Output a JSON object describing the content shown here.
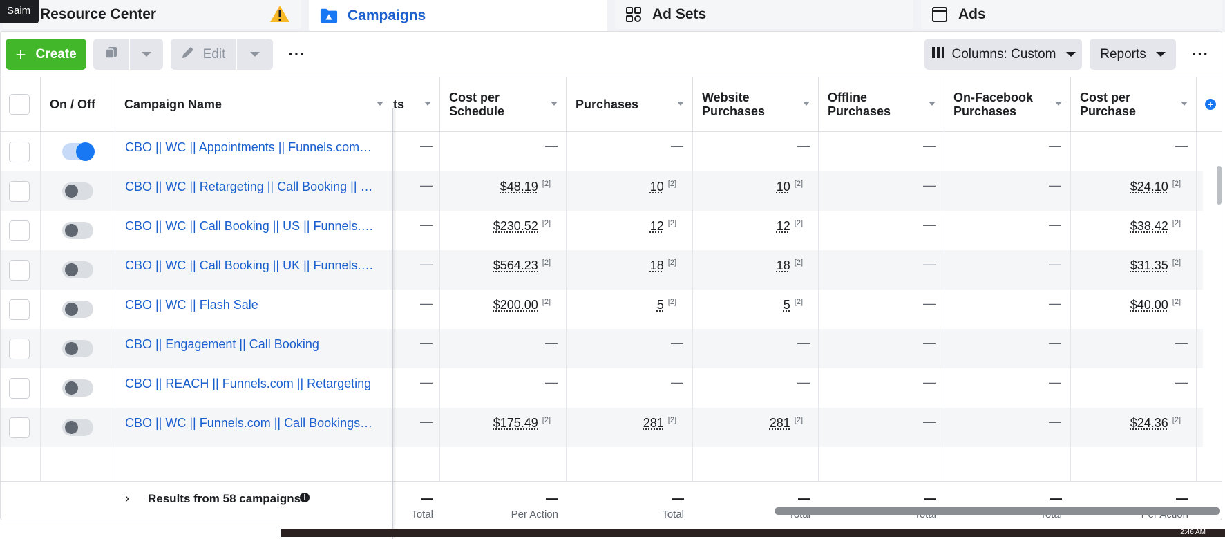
{
  "tabs": [
    {
      "label": "Resource Center",
      "icon": "warning-icon"
    },
    {
      "label": "Campaigns",
      "icon": "campaign-folder-icon"
    },
    {
      "label": "Ad Sets",
      "icon": "grid-icon"
    },
    {
      "label": "Ads",
      "icon": "ad-window-icon"
    }
  ],
  "user_badge": "Saim",
  "toolbar": {
    "create_label": "Create",
    "edit_label": "Edit",
    "columns_label": "Columns: Custom",
    "reports_label": "Reports"
  },
  "columns": {
    "on_off": "On / Off",
    "campaign_name": "Campaign Name",
    "partial": "ts",
    "cost_per_schedule": "Cost per Schedule",
    "purchases": "Purchases",
    "website_purchases": "Website Purchases",
    "offline_purchases": "Offline Purchases",
    "on_facebook_purchases": "On-Facebook Purchases",
    "cost_per_purchase": "Cost per Purchase"
  },
  "rows": [
    {
      "name": "CBO || WC || Appointments || Funnels.com || S...",
      "on": true,
      "partial": "—",
      "cost_per_schedule": "—",
      "purchases": "—",
      "website_purchases": "—",
      "offline_purchases": "—",
      "on_facebook_purchases": "—",
      "cost_per_purchase": "—"
    },
    {
      "name": "CBO || WC || Retargeting || Call Booking || Fun...",
      "on": false,
      "partial": "—",
      "cost_per_schedule": "$48.19",
      "purchases": "10",
      "website_purchases": "10",
      "offline_purchases": "—",
      "on_facebook_purchases": "—",
      "cost_per_purchase": "$24.10"
    },
    {
      "name": "CBO || WC || Call Booking || US || Funnels.com",
      "on": false,
      "partial": "—",
      "cost_per_schedule": "$230.52",
      "purchases": "12",
      "website_purchases": "12",
      "offline_purchases": "—",
      "on_facebook_purchases": "—",
      "cost_per_purchase": "$38.42"
    },
    {
      "name": "CBO || WC || Call Booking || UK || Funnels.com",
      "on": false,
      "partial": "—",
      "cost_per_schedule": "$564.23",
      "purchases": "18",
      "website_purchases": "18",
      "offline_purchases": "—",
      "on_facebook_purchases": "—",
      "cost_per_purchase": "$31.35"
    },
    {
      "name": "CBO || WC || Flash Sale",
      "on": false,
      "partial": "—",
      "cost_per_schedule": "$200.00",
      "purchases": "5",
      "website_purchases": "5",
      "offline_purchases": "—",
      "on_facebook_purchases": "—",
      "cost_per_purchase": "$40.00"
    },
    {
      "name": "CBO || Engagement || Call Booking",
      "on": false,
      "partial": "—",
      "cost_per_schedule": "—",
      "purchases": "—",
      "website_purchases": "—",
      "offline_purchases": "—",
      "on_facebook_purchases": "—",
      "cost_per_purchase": "—"
    },
    {
      "name": "CBO || REACH || Funnels.com || Retargeting",
      "on": false,
      "partial": "—",
      "cost_per_schedule": "—",
      "purchases": "—",
      "website_purchases": "—",
      "offline_purchases": "—",
      "on_facebook_purchases": "—",
      "cost_per_purchase": "—"
    },
    {
      "name": "CBO || WC || Funnels.com || Call Bookings || C...",
      "on": false,
      "partial": "—",
      "cost_per_schedule": "$175.49",
      "purchases": "281",
      "website_purchases": "281",
      "offline_purchases": "—",
      "on_facebook_purchases": "—",
      "cost_per_purchase": "$24.36"
    }
  ],
  "attribution_marker": "[2]",
  "footer": {
    "results_label": "Results from 58 campaigns",
    "totals": [
      {
        "value": "—",
        "label": "Total"
      },
      {
        "value": "—",
        "label": "Per Action"
      },
      {
        "value": "—",
        "label": "Total"
      },
      {
        "value": "—",
        "label": "Total"
      },
      {
        "value": "—",
        "label": "Total"
      },
      {
        "value": "—",
        "label": "Total"
      },
      {
        "value": "—",
        "label": "Per Action"
      }
    ]
  },
  "colors": {
    "accent": "#1877f2",
    "create": "#42b72a",
    "link": "#1a5fce"
  },
  "taskbar_clock": "2:46 AM"
}
